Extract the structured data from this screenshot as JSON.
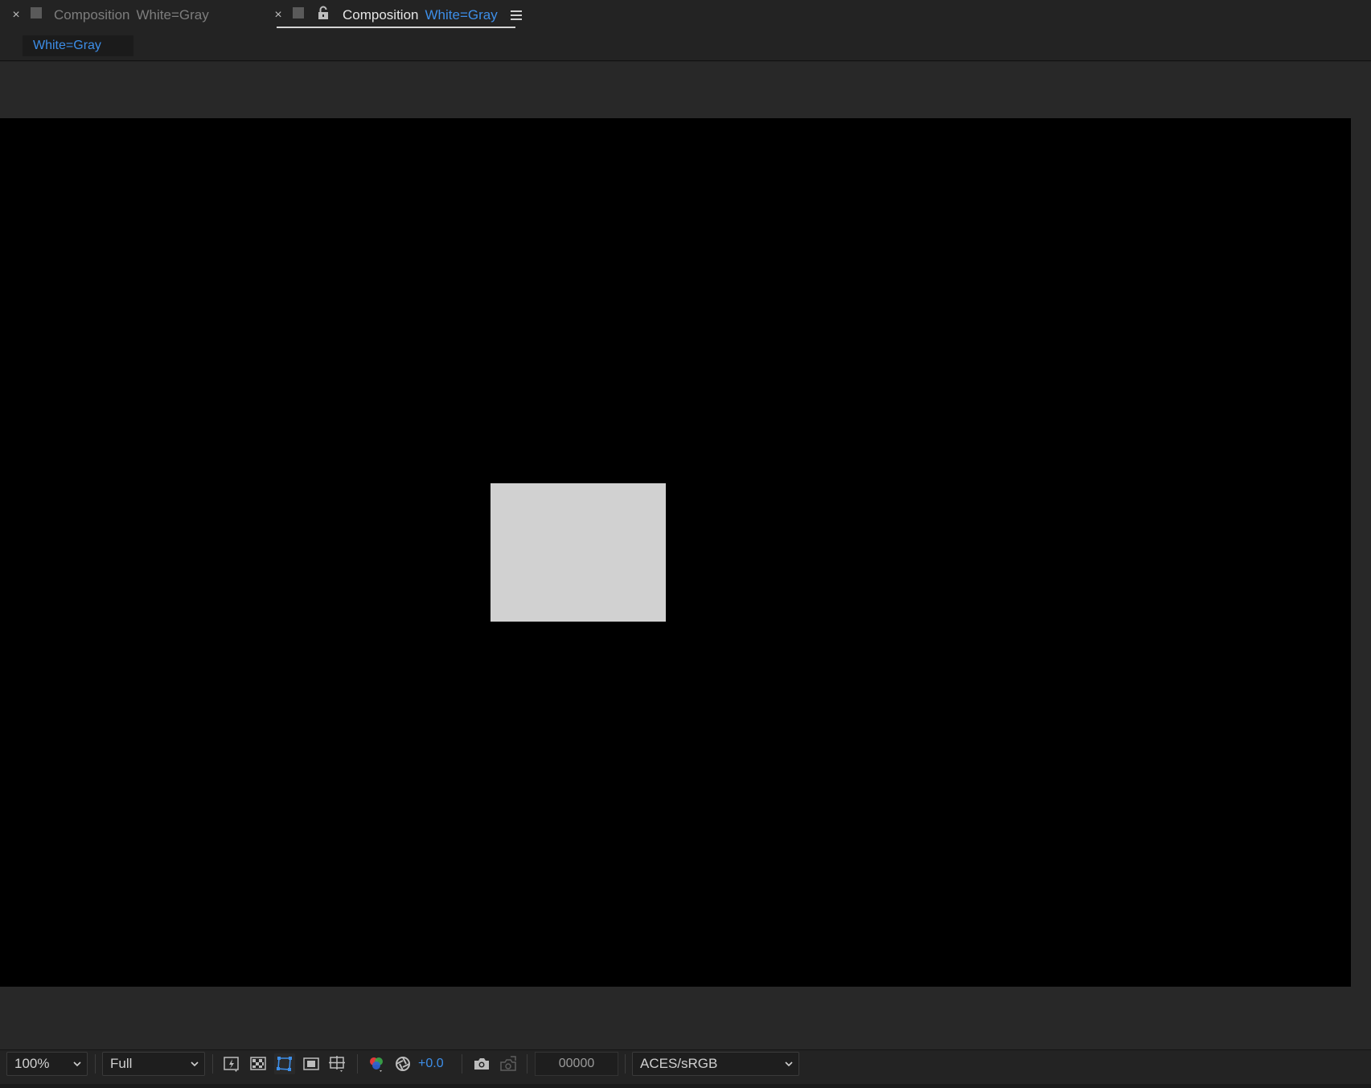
{
  "tabs": [
    {
      "label": "Composition",
      "comp_name": "White=Gray",
      "close_glyph": "×",
      "color": "#5a5a5a",
      "active": false
    },
    {
      "label": "Composition",
      "comp_name": "White=Gray",
      "close_glyph": "×",
      "color": "#5a5a5a",
      "active": true,
      "locked": true
    }
  ],
  "breadcrumb": {
    "label": "White=Gray"
  },
  "viewer": {
    "background": "#000000",
    "layer_color": "#d1d1d1"
  },
  "toolbar": {
    "magnification": "100%",
    "resolution": "Full",
    "exposure": "+0.0",
    "timecode": "00000",
    "color_management": "ACES/sRGB",
    "icons": [
      "fast-previews-icon",
      "transparency-grid-icon",
      "mask-path-visibility-icon",
      "region-of-interest-icon",
      "grid-guide-icon",
      "channel-rgb-icon",
      "reset-exposure-icon",
      "snapshot-camera-icon",
      "show-snapshot-icon"
    ]
  },
  "colors": {
    "accent": "#3d8ee8",
    "panel": "#232323",
    "pasteboard": "#282828"
  }
}
